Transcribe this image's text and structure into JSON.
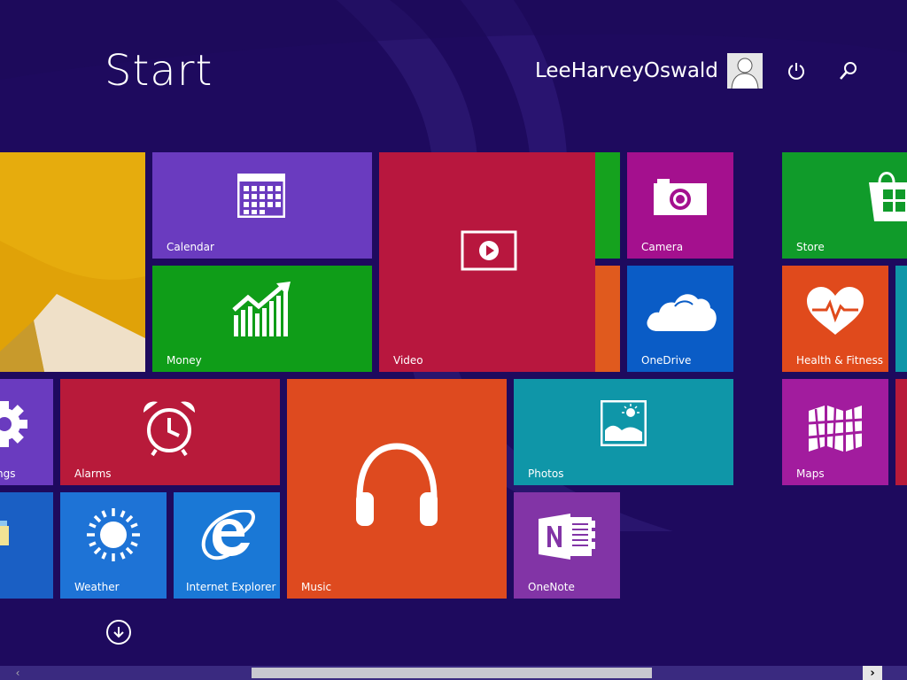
{
  "header": {
    "title": "Start",
    "user_name": "LeeHarveyOswald"
  },
  "icons": {
    "power": "power-icon",
    "search": "search-icon",
    "all_apps": "arrow-down-circle-icon"
  },
  "tiles": {
    "desktop": {
      "label": ""
    },
    "calendar": {
      "label": "Calendar"
    },
    "video": {
      "label": "Video"
    },
    "camera": {
      "label": "Camera"
    },
    "money": {
      "label": "Money"
    },
    "onedrive": {
      "label": "OneDrive"
    },
    "store": {
      "label": "Store"
    },
    "health": {
      "label": "Health & Fitness"
    },
    "settings": {
      "label": "ngs"
    },
    "alarms": {
      "label": "Alarms"
    },
    "music": {
      "label": "Music"
    },
    "photos": {
      "label": "Photos"
    },
    "maps": {
      "label": "Maps"
    },
    "weather": {
      "label": "Weather"
    },
    "ie": {
      "label": "Internet Explorer"
    },
    "onenote": {
      "label": "OneNote"
    }
  },
  "colors": {
    "background": "#1e0a5e",
    "calendar": "#6a3bbf",
    "video": "#b8173e",
    "camera": "#a4108e",
    "money": "#0f9d18",
    "onedrive": "#0a5cc6",
    "store": "#109b2a",
    "health": "#e04a1c",
    "alarms": "#b81a3a",
    "music": "#de4a1f",
    "photos": "#0f96a8",
    "maps": "#a21c9e",
    "weather": "#1e73d6",
    "ie": "#1a78d6",
    "onenote": "#8234a6"
  }
}
